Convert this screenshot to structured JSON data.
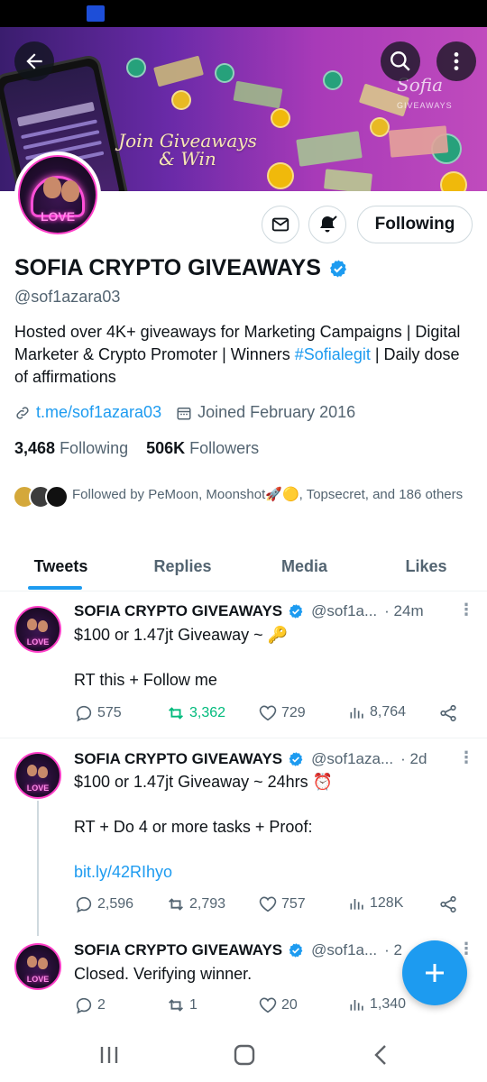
{
  "banner": {
    "tagline_line1": "Join Giveaways",
    "tagline_line2": "& Win",
    "brand": "Sofia",
    "brand_sub": "GIVEAWAYS"
  },
  "avatar": {
    "text": "LOVE"
  },
  "profile": {
    "following_button": "Following",
    "name": "SOFIA CRYPTO GIVEAWAYS",
    "handle": "@sof1azara03",
    "bio_part1": "Hosted over 4K+ giveaways for Marketing Campaigns | Digital Marketer & Crypto Promoter | Winners ",
    "bio_hashtag": "#Sofialegit",
    "bio_part2": " | Daily dose of affirmations",
    "link": "t.me/sof1azara03",
    "joined": "Joined February 2016",
    "following_count": "3,468",
    "following_label": "Following",
    "followers_count": "506K",
    "followers_label": "Followers",
    "followed_by": "Followed by PeMoon, Moonshot🚀🟡, Topsecret, and 186 others"
  },
  "tabs": [
    {
      "label": "Tweets"
    },
    {
      "label": "Replies"
    },
    {
      "label": "Media"
    },
    {
      "label": "Likes"
    }
  ],
  "tweets": [
    {
      "name": "SOFIA CRYPTO GIVEAWAYS",
      "handle": "@sof1a...",
      "time": "· 24m",
      "line1": "$100 or 1.47jt Giveaway ~ 🔑",
      "line2": "RT this + Follow me",
      "replies": "575",
      "retweets": "3,362",
      "likes": "729",
      "views": "8,764"
    },
    {
      "name": "SOFIA CRYPTO GIVEAWAYS",
      "handle": "@sof1aza...",
      "time": "· 2d",
      "line1": "$100 or 1.47jt Giveaway ~ 24hrs ⏰",
      "line2": "RT + Do 4 or more tasks + Proof:",
      "link": "bit.ly/42RIhyo",
      "replies": "2,596",
      "retweets": "2,793",
      "likes": "757",
      "views": "128K"
    },
    {
      "name": "SOFIA CRYPTO GIVEAWAYS",
      "handle": "@sof1a...",
      "time": "· 2",
      "line1": "Closed. Verifying winner.",
      "replies": "2",
      "retweets": "1",
      "likes": "20",
      "views": "1,340"
    }
  ],
  "colors": {
    "accent": "#1d9bf0",
    "retweet_active": "#00ba7c",
    "text": "#0f1419",
    "muted": "#536471"
  }
}
